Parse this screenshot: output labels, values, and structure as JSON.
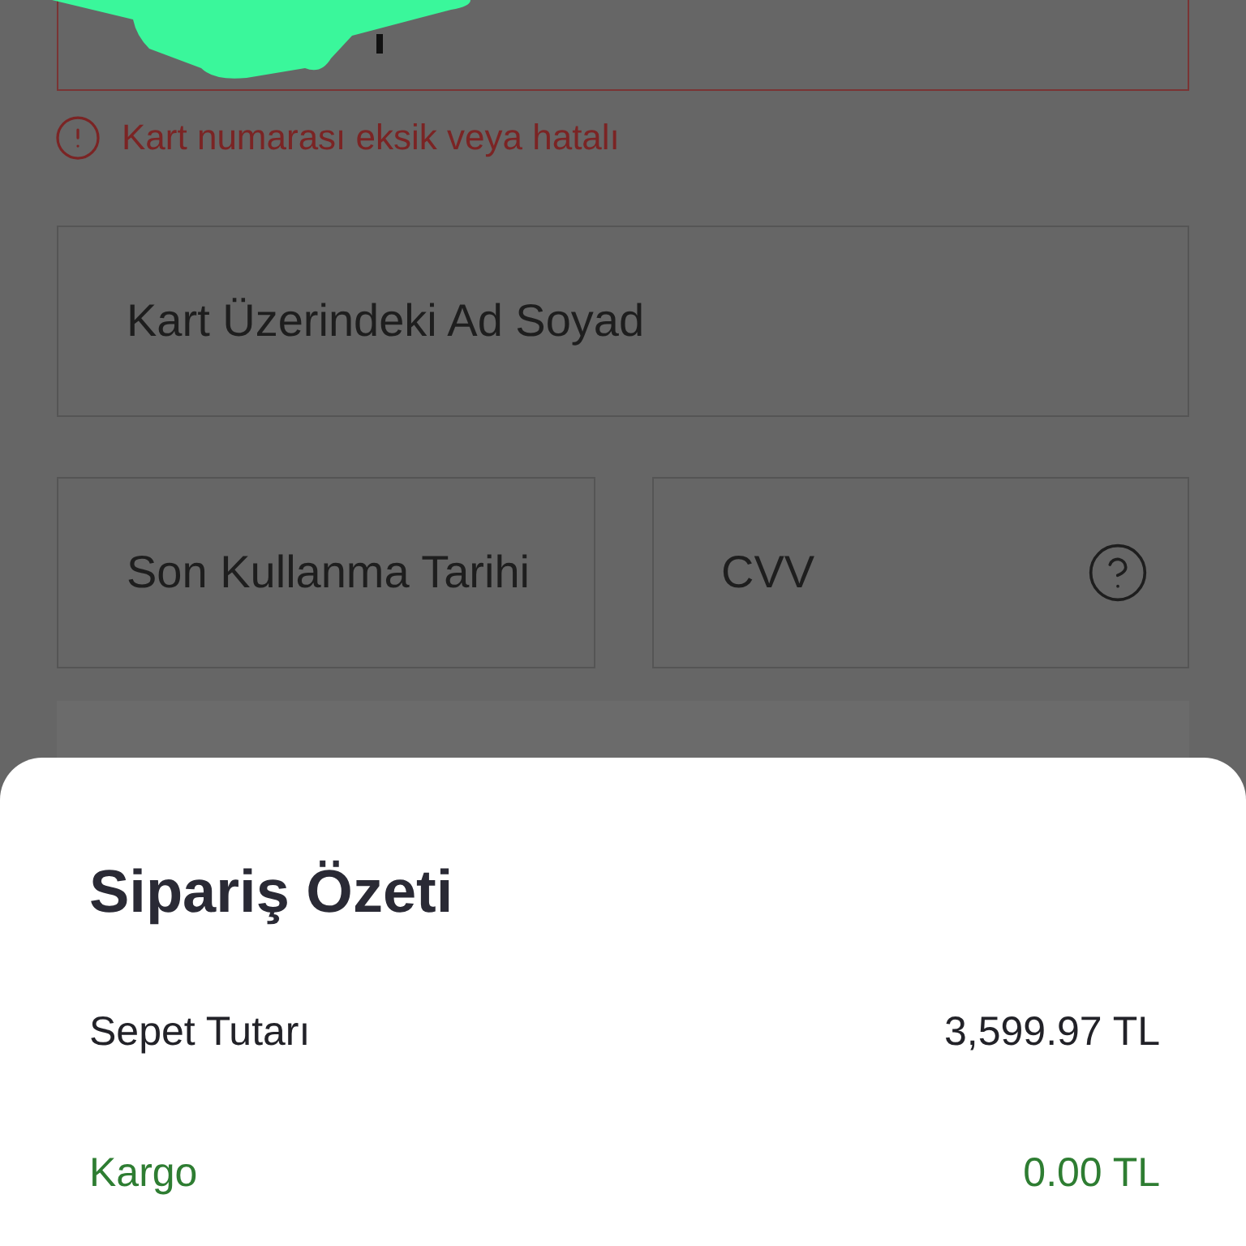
{
  "form": {
    "card_number_field": {
      "error": true,
      "focused": true,
      "redacted": true
    },
    "card_number_error": "Kart numarası eksik veya hatalı",
    "name_field": {
      "placeholder": "Kart Üzerindeki Ad Soyad"
    },
    "expiry_field": {
      "placeholder": "Son Kullanma Tarihi"
    },
    "cvv_field": {
      "placeholder": "CVV",
      "help": true
    }
  },
  "order_summary": {
    "title": "Sipariş Özeti",
    "rows": [
      {
        "kind": "subtotal",
        "label": "Sepet Tutarı",
        "value": "3,599.97 TL"
      },
      {
        "kind": "shipping",
        "label": "Kargo",
        "value": "0.00 TL"
      }
    ]
  }
}
